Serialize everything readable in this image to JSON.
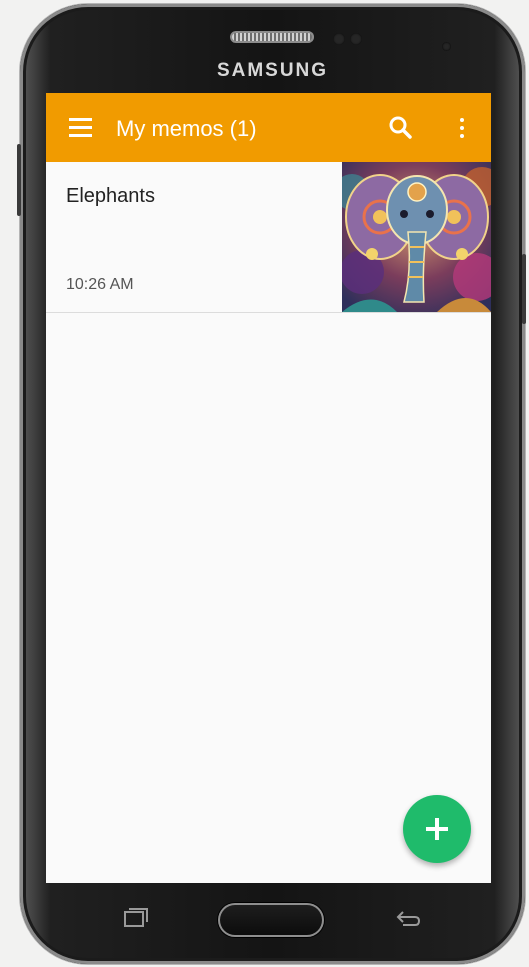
{
  "device": {
    "brand": "SAMSUNG"
  },
  "appbar": {
    "title": "My memos (1)",
    "menu_icon": "hamburger-menu-icon",
    "search_icon": "search-icon",
    "more_icon": "more-vertical-icon",
    "color": "#f19b00"
  },
  "memos": [
    {
      "title": "Elephants",
      "time": "10:26 AM",
      "thumbnail": "elephant-painting-thumbnail"
    }
  ],
  "fab": {
    "icon": "plus-icon",
    "color": "#1fbb6b"
  },
  "nav": {
    "recent_icon": "recent-apps-icon",
    "home_icon": "home-button",
    "back_icon": "back-arrow-icon"
  }
}
